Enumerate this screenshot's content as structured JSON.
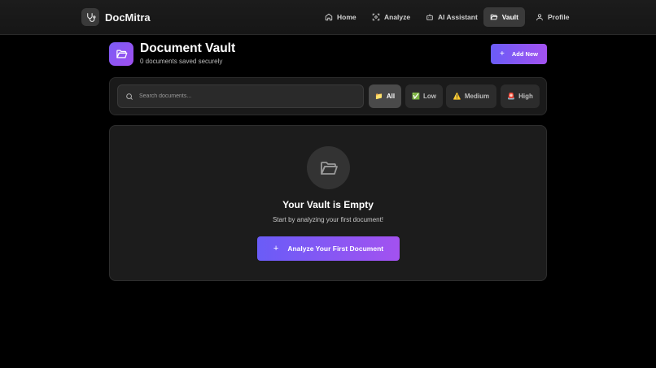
{
  "brand": {
    "name": "DocMitra",
    "icon": "stethoscope-icon"
  },
  "nav": {
    "items": [
      {
        "label": "Home",
        "icon": "home-icon",
        "active": false
      },
      {
        "label": "Analyze",
        "icon": "scan-icon",
        "active": false
      },
      {
        "label": "AI Assistant",
        "icon": "bot-icon",
        "active": false
      },
      {
        "label": "Vault",
        "icon": "folder-open-icon",
        "active": true
      },
      {
        "label": "Profile",
        "icon": "user-icon",
        "active": false
      }
    ]
  },
  "header": {
    "title": "Document Vault",
    "subtitle": "0 documents saved securely",
    "add_button": "Add New",
    "add_icon": "+"
  },
  "filters": {
    "search_placeholder": "Search documents...",
    "chips": [
      {
        "emoji": "📁",
        "label": "All",
        "active": true
      },
      {
        "emoji": "✅",
        "label": "Low",
        "active": false
      },
      {
        "emoji": "⚠️",
        "label": "Medium",
        "active": false
      },
      {
        "emoji": "🚨",
        "label": "High",
        "active": false
      }
    ]
  },
  "empty_state": {
    "title": "Your Vault is Empty",
    "subtitle": "Start by analyzing your first document!",
    "cta": "Analyze Your First Document",
    "cta_icon": "+"
  },
  "colors": {
    "accent_start": "#6a5cf7",
    "accent_end": "#a352f0",
    "background": "#000000"
  }
}
